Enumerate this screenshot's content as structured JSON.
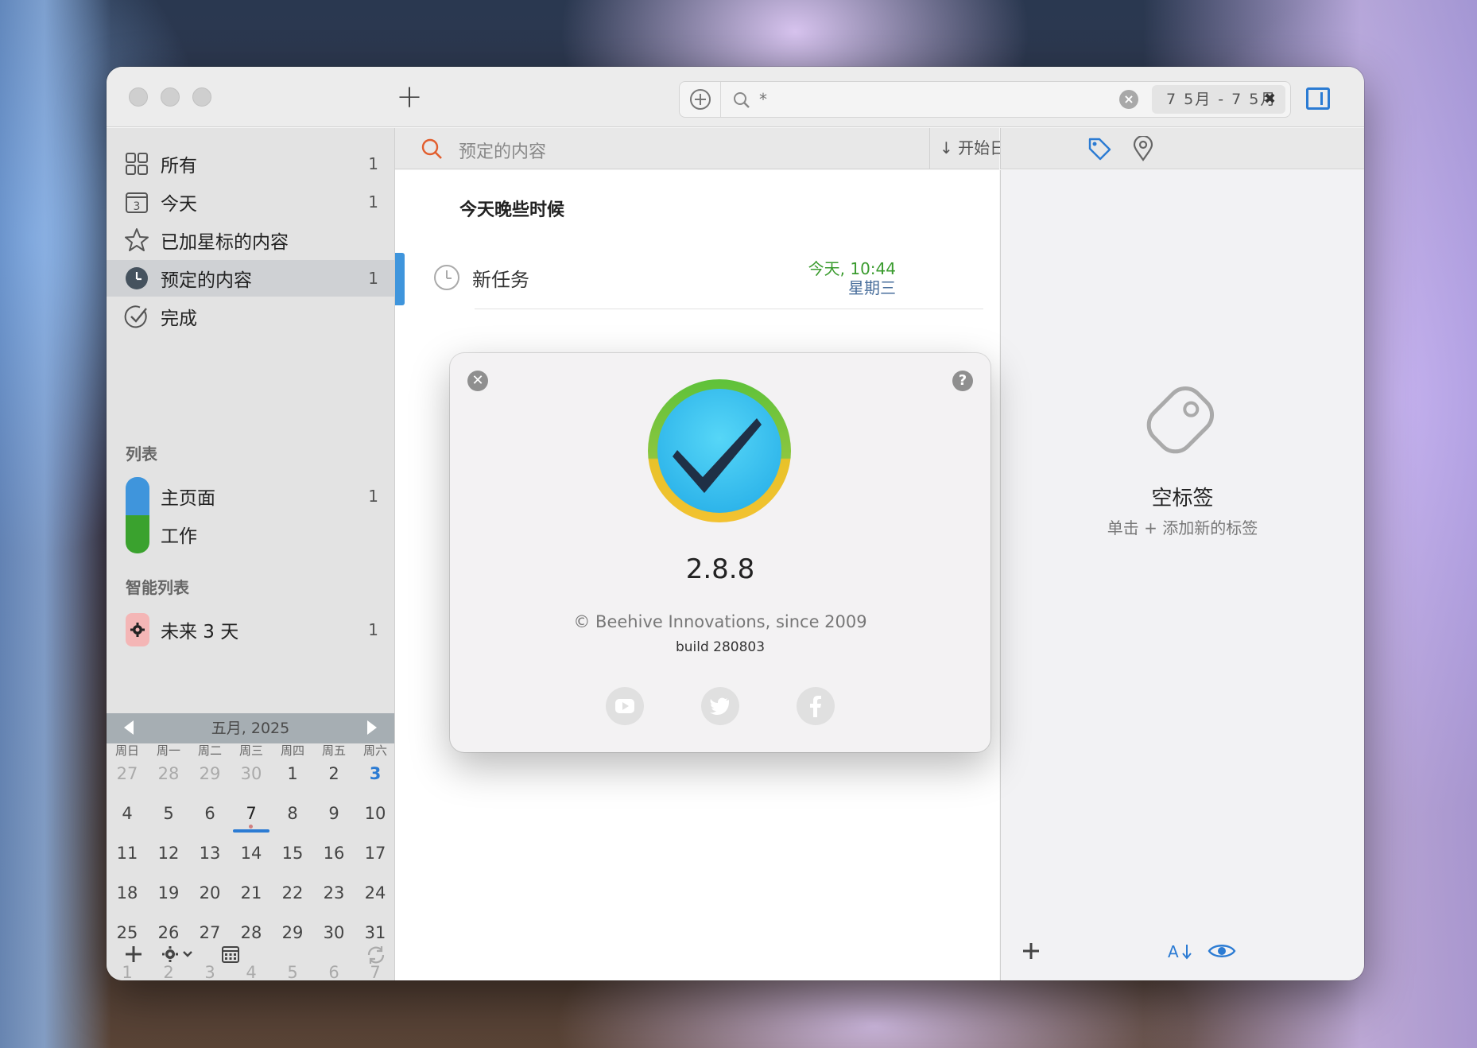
{
  "toolbar": {
    "add_label": "+",
    "search_placeholder": "*",
    "date_range": "7 5月 - 7 5月",
    "date_range_clear": "✖"
  },
  "sidebar": {
    "items": [
      {
        "label": "所有",
        "count": "1"
      },
      {
        "label": "今天",
        "count": "1",
        "icon_text": "3"
      },
      {
        "label": "已加星标的内容",
        "count": ""
      },
      {
        "label": "预定的内容",
        "count": "1"
      },
      {
        "label": "完成",
        "count": ""
      }
    ],
    "lists_header": "列表",
    "lists": [
      {
        "label": "主页面",
        "count": "1",
        "color": "#3f95dc"
      },
      {
        "label": "工作",
        "count": "",
        "color": "#3aa22e"
      }
    ],
    "smart_header": "智能列表",
    "smart_lists": [
      {
        "label": "未来 3 天",
        "count": "1",
        "color": "#f4b6b6"
      }
    ]
  },
  "calendar": {
    "month": "五月, 2025",
    "weekdays": [
      "周日",
      "周一",
      "周二",
      "周三",
      "周四",
      "周五",
      "周六"
    ],
    "weeks": [
      [
        "27",
        "28",
        "29",
        "30",
        "1",
        "2",
        "3"
      ],
      [
        "4",
        "5",
        "6",
        "7",
        "8",
        "9",
        "10"
      ],
      [
        "11",
        "12",
        "13",
        "14",
        "15",
        "16",
        "17"
      ],
      [
        "18",
        "19",
        "20",
        "21",
        "22",
        "23",
        "24"
      ],
      [
        "25",
        "26",
        "27",
        "28",
        "29",
        "30",
        "31"
      ],
      [
        "1",
        "2",
        "3",
        "4",
        "5",
        "6",
        "7"
      ]
    ],
    "today": "3",
    "selected": "7"
  },
  "main": {
    "title": "预定的内容",
    "sort_label": "开始日期",
    "group_title": "今天晚些时候",
    "tasks": [
      {
        "name": "新任务",
        "date": "今天, 10:44",
        "weekday": "星期三"
      }
    ]
  },
  "right_panel": {
    "empty_title": "空标签",
    "empty_subtitle": "单击 + 添加新的标签"
  },
  "about": {
    "version": "2.8.8",
    "copyright": "© Beehive Innovations, since 2009",
    "build": "build 280803",
    "close_label": "✕",
    "help_label": "?"
  },
  "colors": {
    "accent": "#2b7bd3",
    "green": "#3a9b2e",
    "list_blue": "#3f95dc"
  }
}
